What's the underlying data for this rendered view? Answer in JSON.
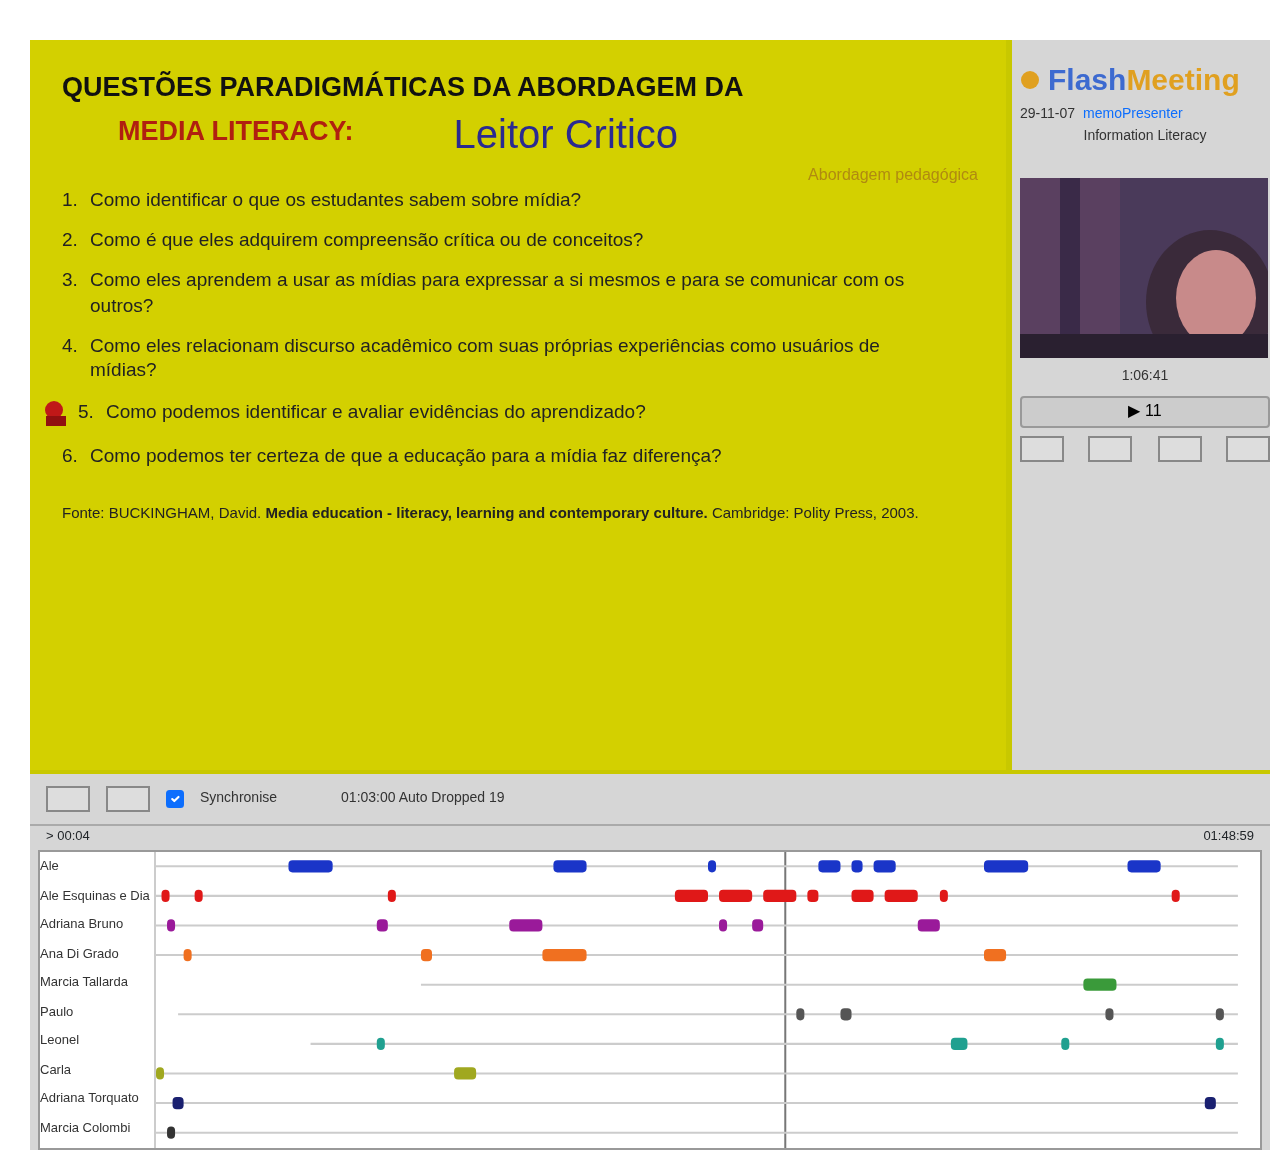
{
  "slide": {
    "title": "QUESTÕES PARADIGMÁTICAS DA ABORDAGEM DA",
    "subtitle": "MEDIA LITERACY:",
    "heading": "Leitor Critico",
    "tag": "Abordagem pedagógica",
    "questions": [
      {
        "number": "1.",
        "text": "Como identificar o que os estudantes sabem sobre mídia?",
        "marker": false
      },
      {
        "number": "2.",
        "text": "Como é que eles adquirem compreensão crítica ou de conceitos?",
        "marker": false
      },
      {
        "number": "3.",
        "text": "Como eles aprendem a usar as mídias para expressar a si mesmos e para se comunicar com os outros?",
        "marker": false
      },
      {
        "number": "4.",
        "text": "Como eles relacionam discurso acadêmico com suas próprias experiências como usuários de mídias?",
        "marker": false
      },
      {
        "number": "5.",
        "text": "Como podemos identificar e avaliar evidências do aprendizado?",
        "marker": true
      },
      {
        "number": "6.",
        "text": "Como podemos ter certeza de que a educação para a mídia faz diferença?",
        "marker": false
      }
    ],
    "source": "Fonte: BUCKINGHAM, David. **Media education - literacy, learning and contemporary culture.** Cambridge: Polity Press, 2003."
  },
  "side": {
    "brand_a": "Flash",
    "brand_b": "Meeting",
    "date": "29-11-07",
    "presenter": "memoPresenter",
    "meeting": "Information Literacy",
    "time": "1:06:41",
    "play": "▶ 11"
  },
  "toolbar": {
    "synchronise": {
      "label": "Synchronise",
      "checked": true
    },
    "event": "01:03:00 Auto Dropped 19"
  },
  "timeline": {
    "start": "> 00:04",
    "end": "01:48:59",
    "participants": [
      {
        "name": "Ale",
        "color": "#1a35c8"
      },
      {
        "name": "Ale Esquinas e Dia",
        "color": "#e01818"
      },
      {
        "name": "Adriana Bruno",
        "color": "#9a1a9a"
      },
      {
        "name": "Ana Di Grado",
        "color": "#f07020"
      },
      {
        "name": "Marcia Tallarda",
        "color": "#3a9a3a"
      },
      {
        "name": "Paulo",
        "color": "#555555"
      },
      {
        "name": "Leonel",
        "color": "#20a090"
      },
      {
        "name": "Carla",
        "color": "#a0a820"
      },
      {
        "name": "Adriana Torquato",
        "color": "#1a2070"
      },
      {
        "name": "Marcia Colombi",
        "color": "#333333"
      }
    ]
  }
}
